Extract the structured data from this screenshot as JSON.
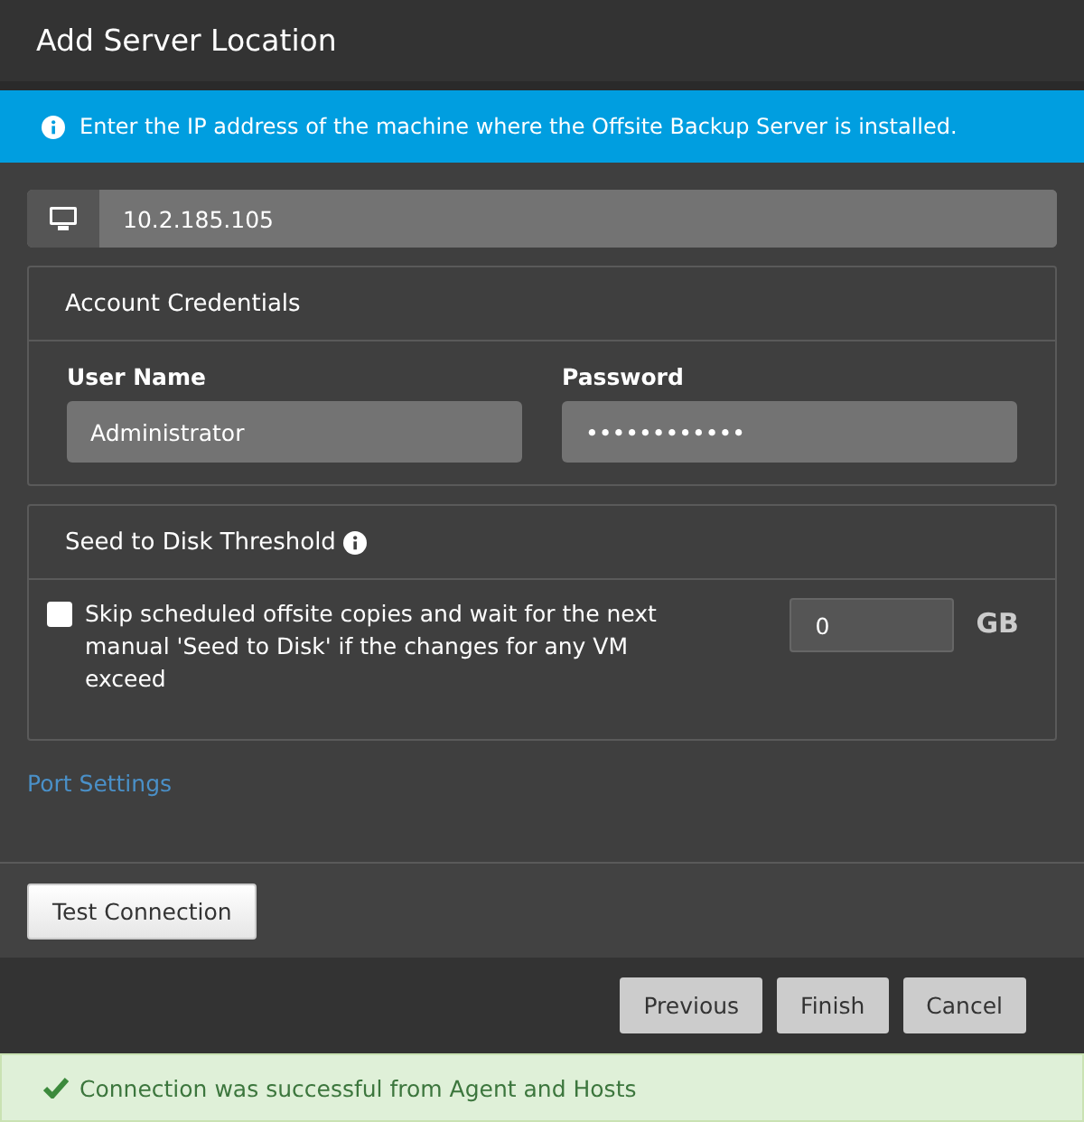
{
  "window": {
    "title": "Add Server Location"
  },
  "info_banner": {
    "text": "Enter the IP address of the machine where the Offsite Backup Server is installed."
  },
  "server_address": {
    "value": "10.2.185.105"
  },
  "account_credentials": {
    "title": "Account Credentials",
    "fields": [
      {
        "label": "User Name",
        "value": "Administrator"
      },
      {
        "label": "Password",
        "value": "••••••••••••"
      }
    ]
  },
  "seed_threshold": {
    "title": "Seed to Disk Threshold",
    "checkbox": {
      "label": "Skip scheduled offsite copies and wait for the next manual 'Seed to Disk' if the changes for any VM exceed",
      "checked": false
    },
    "amount": "0",
    "unit": "GB"
  },
  "port_settings_link": "Port Settings",
  "test_button": "Test Connection",
  "buttons": [
    "Previous",
    "Finish",
    "Cancel"
  ],
  "status": {
    "kind": "success",
    "text": "Connection was successful from Agent and Hosts"
  }
}
